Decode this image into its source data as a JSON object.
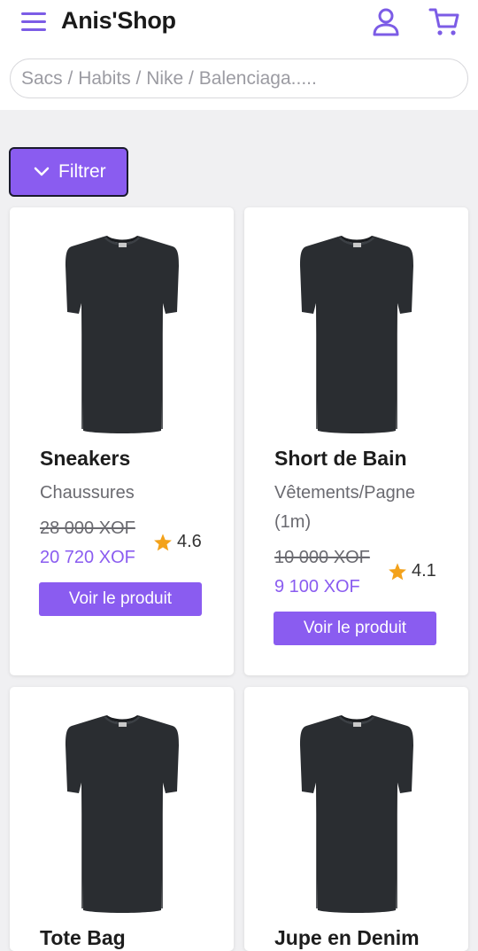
{
  "header": {
    "brand": "Anis'Shop",
    "accent_color": "#8a5cf0"
  },
  "search": {
    "placeholder": "Sacs / Habits / Nike / Balenciaga.....",
    "value": ""
  },
  "filter": {
    "label": "Filtrer"
  },
  "products": [
    {
      "name": "Sneakers",
      "category": "Chaussures",
      "old_price": "28 000 XOF",
      "price": "20 720 XOF",
      "rating": "4.6",
      "button": "Voir le produit",
      "image_icon": "tshirt-icon"
    },
    {
      "name": "Short de Bain",
      "category": "Vêtements/Pagne (1m)",
      "old_price": "10 000 XOF",
      "price": "9 100 XOF",
      "rating": "4.1",
      "button": "Voir le produit",
      "image_icon": "tshirt-icon"
    },
    {
      "name": "Tote Bag",
      "image_icon": "tshirt-icon"
    },
    {
      "name": "Jupe en Denim",
      "image_icon": "tshirt-icon"
    }
  ]
}
